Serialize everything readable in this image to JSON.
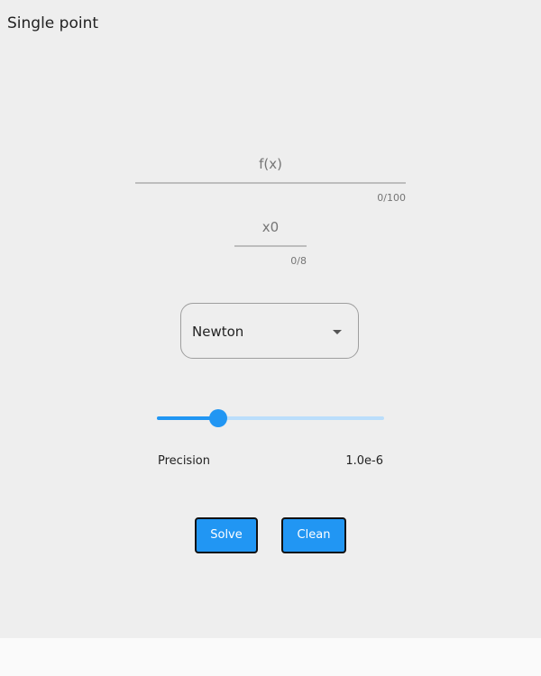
{
  "page": {
    "title": "Single point"
  },
  "form": {
    "fx": {
      "label": "f(x)",
      "counter": "0/100",
      "value": ""
    },
    "x0": {
      "label": "x0",
      "counter": "0/8",
      "value": ""
    },
    "method": {
      "selected": "Newton"
    },
    "precision": {
      "label": "Precision",
      "value_text": "1.0e-6",
      "slider_fraction": 0.27
    }
  },
  "actions": {
    "solve_label": "Solve",
    "clean_label": "Clean"
  },
  "colors": {
    "accent": "#2196f3",
    "accent_light": "#bbdefb",
    "panel_bg": "#eeeeee"
  }
}
